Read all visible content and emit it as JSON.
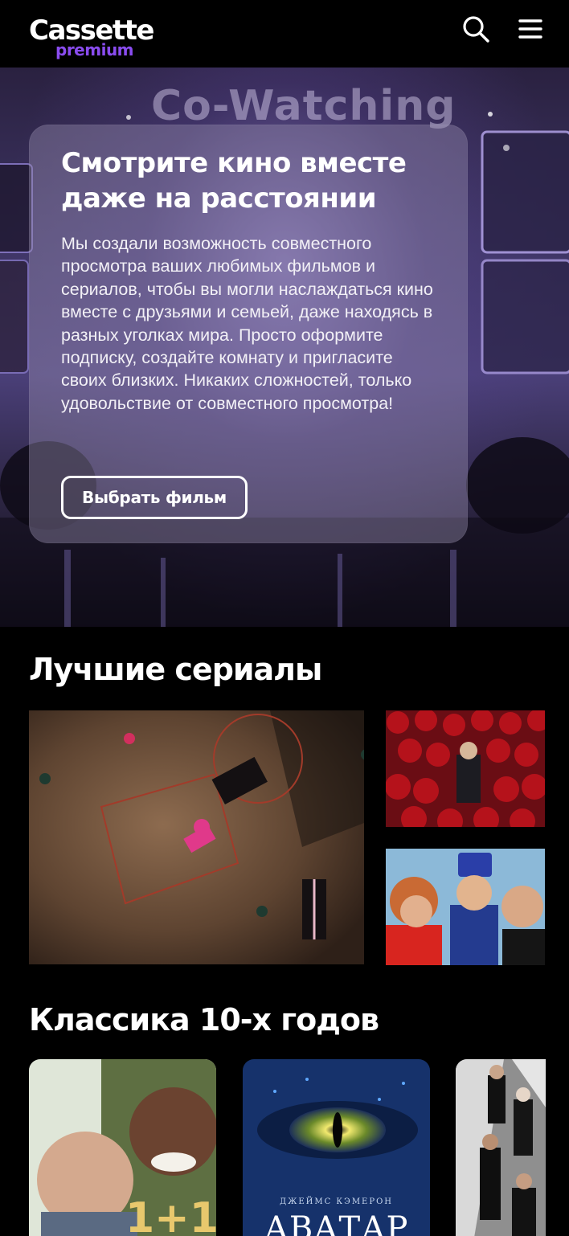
{
  "header": {
    "logo_main": "Cassette",
    "logo_sub": "premium"
  },
  "hero": {
    "background_text": "Co-Watching",
    "title": "Смотрите кино вместе даже на расстоянии",
    "description": "Мы создали возможность совместного просмотра ваших любимых фильмов и сериалов, чтобы вы могли наслаждаться кино вместе с друзьями и семьей, даже находясь в разных уголках мира. Просто оформите подписку, создайте комнату и пригласите своих близких. Никаких сложностей, только удовольствие от совместного просмотра!",
    "button_label": "Выбрать фильм"
  },
  "sections": {
    "series": {
      "title": "Лучшие сериалы"
    },
    "classic": {
      "title": "Классика 10-х годов",
      "posters": {
        "first_caption": "1+1",
        "second_top_caption": "ДЖЕЙМС КЭМЕРОН",
        "second_caption": "АВАТАР"
      }
    }
  },
  "colors": {
    "background": "#000000",
    "accent": "#8a4cf0",
    "text": "#ffffff"
  },
  "icons": [
    "search-icon",
    "menu-icon"
  ]
}
